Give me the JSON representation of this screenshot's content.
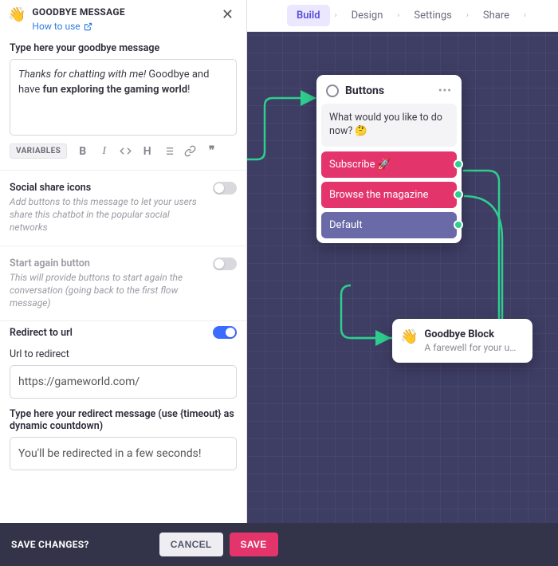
{
  "header": {
    "title": "GOODBYE MESSAGE",
    "how_to_use": "How to use"
  },
  "message": {
    "label": "Type here your goodbye message",
    "italic_part": "Thanks for chatting with me!",
    "plain_part": " Goodbye and have ",
    "bold_part": "fun exploring the gaming world",
    "tail": "!"
  },
  "toolbar": {
    "variables_label": "VARIABLES"
  },
  "social": {
    "title": "Social share icons",
    "desc": "Add buttons to this message to let your users share this chatbot in the popular social networks"
  },
  "start_again": {
    "title": "Start again button",
    "desc": "This will provide buttons to start again the conversation (going back to the first flow message)"
  },
  "redirect": {
    "title": "Redirect to url",
    "url_label": "Url to redirect",
    "url_value": "https://gameworld.com/",
    "msg_label": "Type here your redirect message (use {timeout} as dynamic countdown)",
    "msg_value": "You'll be redirected in a few seconds!"
  },
  "footer": {
    "question": "SAVE CHANGES?",
    "cancel": "CANCEL",
    "save": "SAVE"
  },
  "nav": {
    "build": "Build",
    "design": "Design",
    "settings": "Settings",
    "share": "Share"
  },
  "buttons_node": {
    "title": "Buttons",
    "prompt": "What would you like to do now? 🤔",
    "opt1": "Subscribe 🚀",
    "opt2": "Browse the magazine",
    "opt3": "Default"
  },
  "goodbye_node": {
    "title": "Goodbye Block",
    "sub": "A farewell for your u…"
  }
}
